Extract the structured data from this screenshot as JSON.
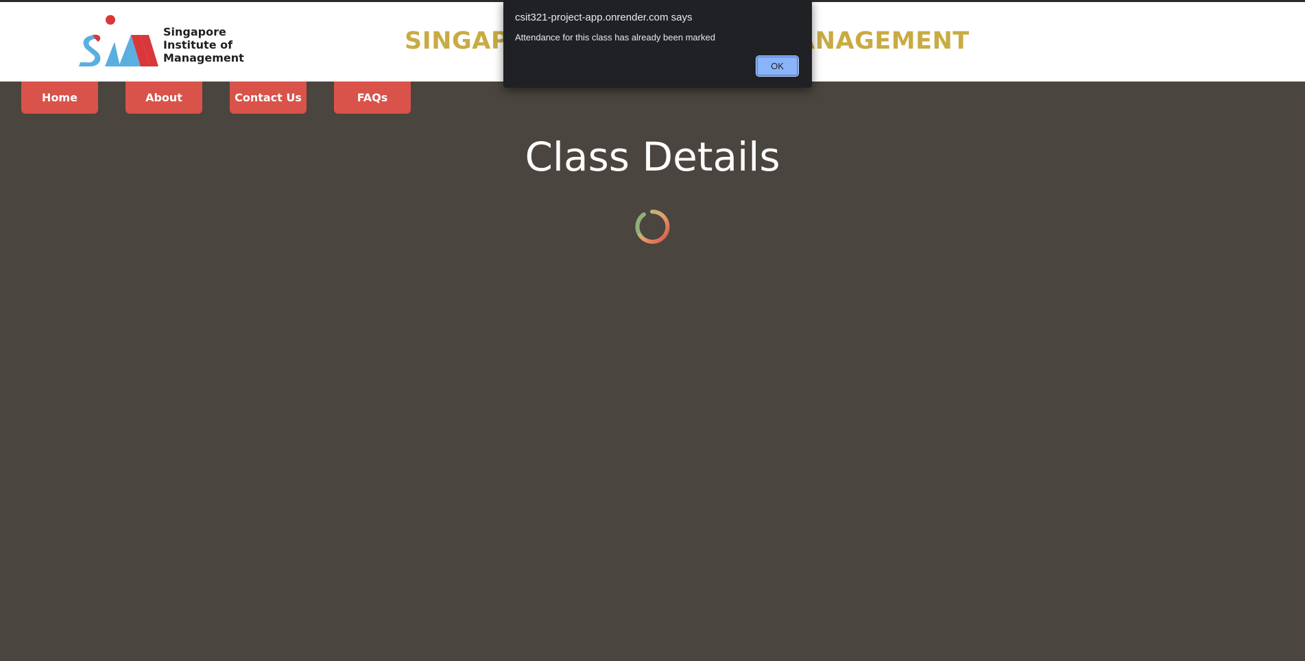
{
  "header": {
    "logo_lines": [
      "Singapore",
      "Institute of",
      "Management"
    ],
    "site_title": "SINGAPORE INSTITUTE OF MANAGEMENT"
  },
  "nav": {
    "items": [
      {
        "label": "Home"
      },
      {
        "label": "About"
      },
      {
        "label": "Contact Us"
      },
      {
        "label": "FAQs"
      }
    ]
  },
  "main": {
    "heading": "Class Details"
  },
  "dialog": {
    "title": "csit321-project-app.onrender.com says",
    "message": "Attendance for this class has already been marked",
    "ok_label": "OK"
  },
  "colors": {
    "background": "#4a453e",
    "nav_button": "#d9534a",
    "title_gold": "#c9ab43",
    "logo_red": "#d9373a",
    "logo_blue": "#5aaee0",
    "dialog_bg": "#202124",
    "dialog_button": "#8ab4f8"
  },
  "icons": {
    "logo": "sim-logo-icon",
    "spinner": "loading-spinner-icon"
  }
}
